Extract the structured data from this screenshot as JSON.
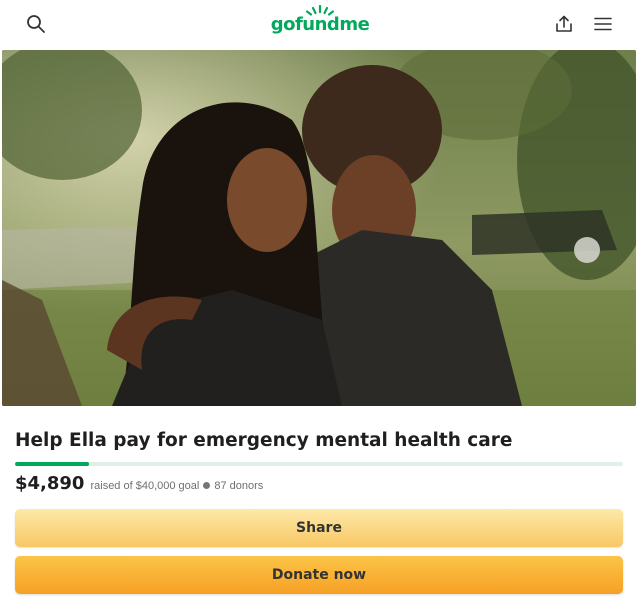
{
  "header": {
    "logo_text": "gofundme",
    "search_icon": "search-icon",
    "share_icon": "share-upload-icon",
    "menu_icon": "hamburger-menu-icon"
  },
  "hero": {
    "description": "photo"
  },
  "campaign": {
    "title": "Help Ella pay for emergency mental health care",
    "amount_raised": "$4,890",
    "goal_text": "raised of $40,000 goal",
    "donors_text": "87 donors",
    "progress_fraction": 0.1223
  },
  "actions": {
    "share_label": "Share",
    "donate_label": "Donate now"
  },
  "colors": {
    "brand_green": "#02a95c",
    "share_button": "#f9d27a",
    "donate_button": "#f8b133"
  }
}
